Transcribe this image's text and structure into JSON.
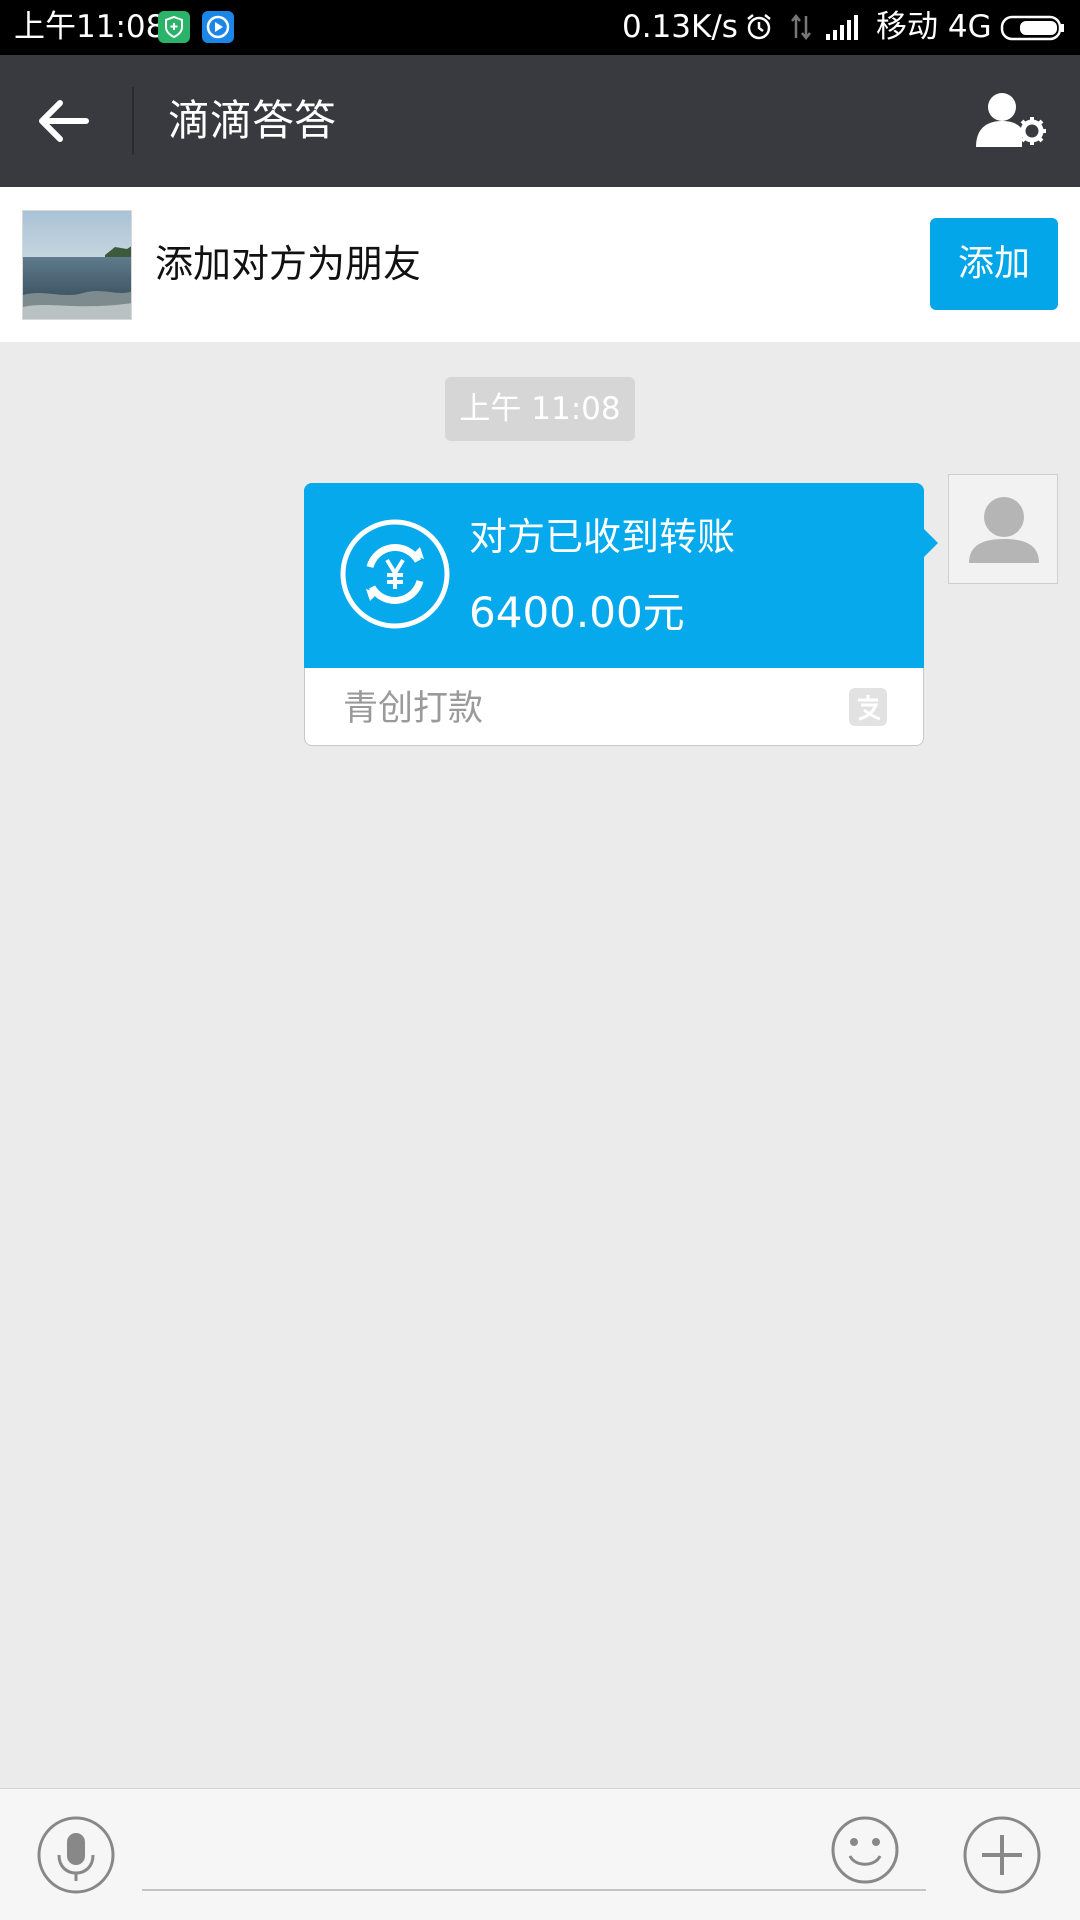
{
  "status_bar": {
    "time": "上午11:08",
    "net_speed": "0.13K/s",
    "carrier": "移动 4G"
  },
  "header": {
    "title": "滴滴答答"
  },
  "add_friend_banner": {
    "text": "添加对方为朋友",
    "button_label": "添加"
  },
  "chat": {
    "timestamp": "上午 11:08",
    "transfer": {
      "status": "对方已收到转账",
      "amount": "6400.00元",
      "note": "青创打款"
    }
  },
  "input_bar": {
    "message_value": "",
    "placeholder": ""
  },
  "colors": {
    "accent": "#03a6e8",
    "title_bar": "#393a3f",
    "chat_background": "#ebebeb"
  },
  "icons": [
    "shield-icon",
    "player-icon",
    "alarm-icon",
    "data-icon",
    "signal-icon",
    "battery-icon",
    "back-arrow-icon",
    "contact-settings-icon",
    "transfer-yen-icon",
    "alipay-icon",
    "default-avatar-icon",
    "microphone-icon",
    "emoji-icon",
    "plus-icon"
  ]
}
